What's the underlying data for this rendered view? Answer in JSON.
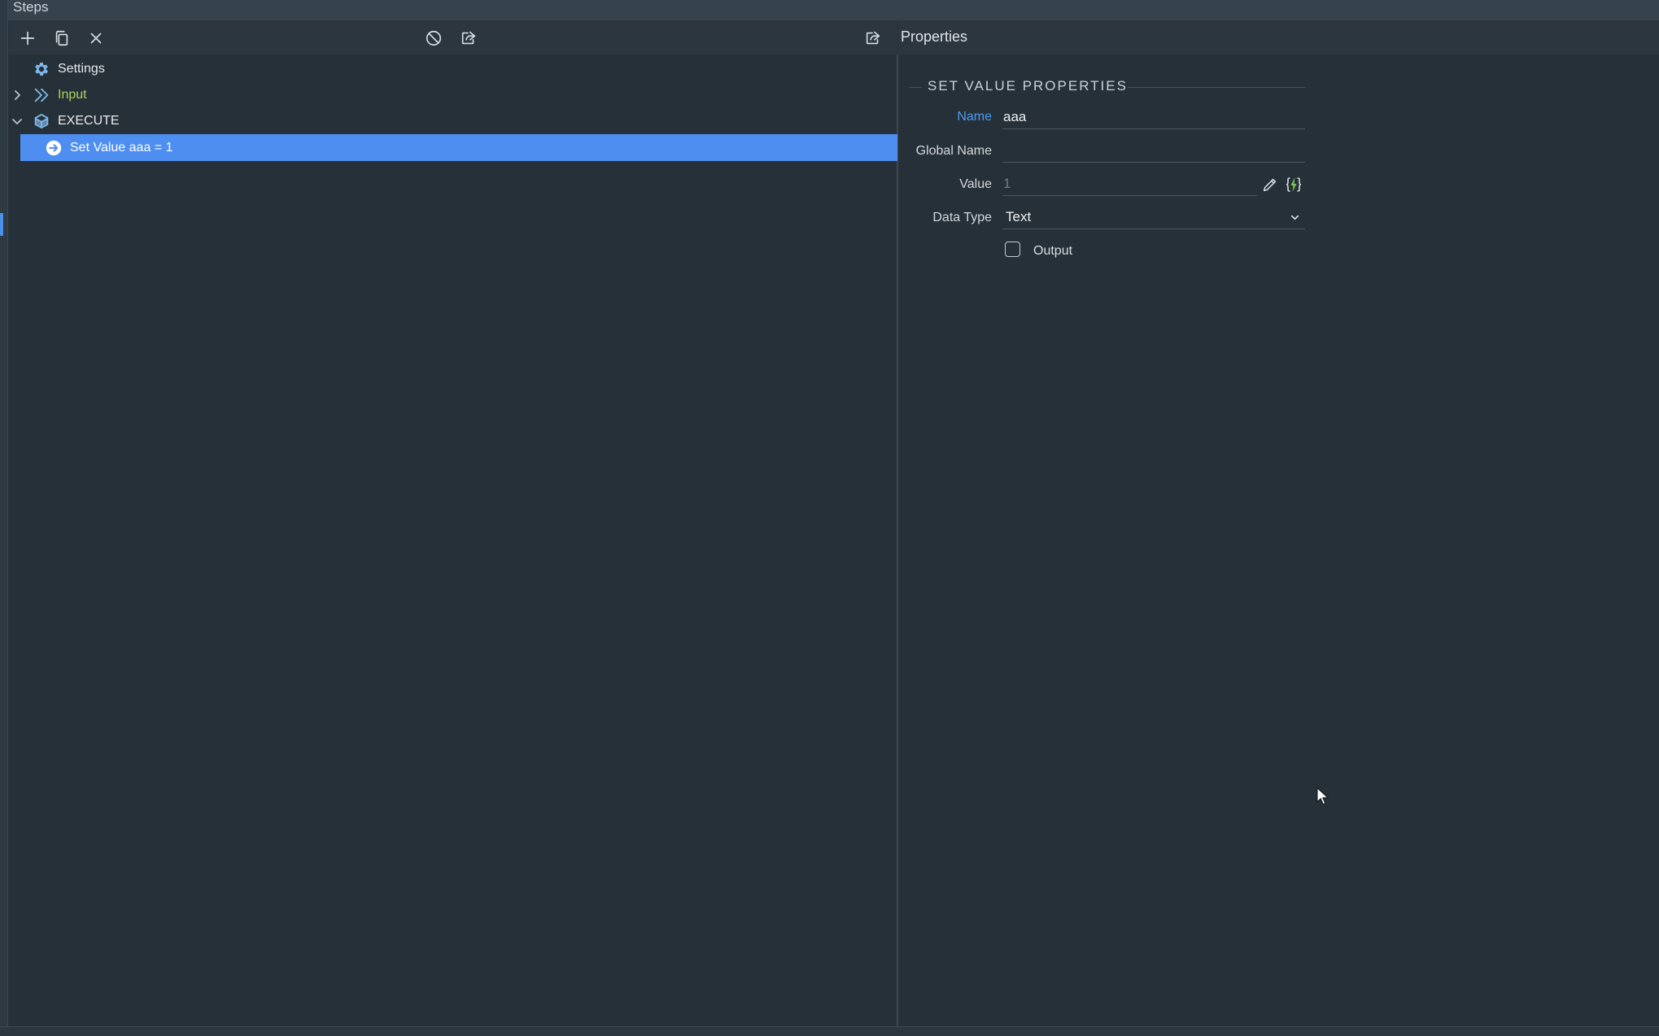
{
  "window": {
    "title": "Steps"
  },
  "toolbar_left": {
    "add": "plus-icon",
    "copy": "copy-icon",
    "delete": "close-icon",
    "disable": "ban-icon",
    "export": "export-icon"
  },
  "properties_panel": {
    "title": "Properties",
    "icon": "share-icon"
  },
  "tree": {
    "items": [
      {
        "label": "Settings",
        "icon": "gear-icon",
        "color": "#e6e9ec"
      },
      {
        "label": "Input",
        "icon": "double-chevron-icon",
        "color": "#a9d461"
      },
      {
        "label": "EXECUTE",
        "icon": "cube-icon",
        "color": "#e6e9ec"
      },
      {
        "label": "Set Value aaa = 1",
        "icon": "arrow-circle-icon",
        "selected": true
      }
    ]
  },
  "set_value": {
    "section_title": "SET VALUE PROPERTIES",
    "name_label": "Name",
    "name_value": "aaa",
    "global_name_label": "Global Name",
    "global_name_value": "",
    "value_label": "Value",
    "value_placeholder": "1",
    "data_type_label": "Data Type",
    "data_type_value": "Text",
    "output_label": "Output",
    "output_checked": false
  },
  "colors": {
    "accent": "#4d8ef0",
    "name_label": "#4d9bf0",
    "input_green": "#a9d461",
    "lightning": "#7ec24f"
  }
}
